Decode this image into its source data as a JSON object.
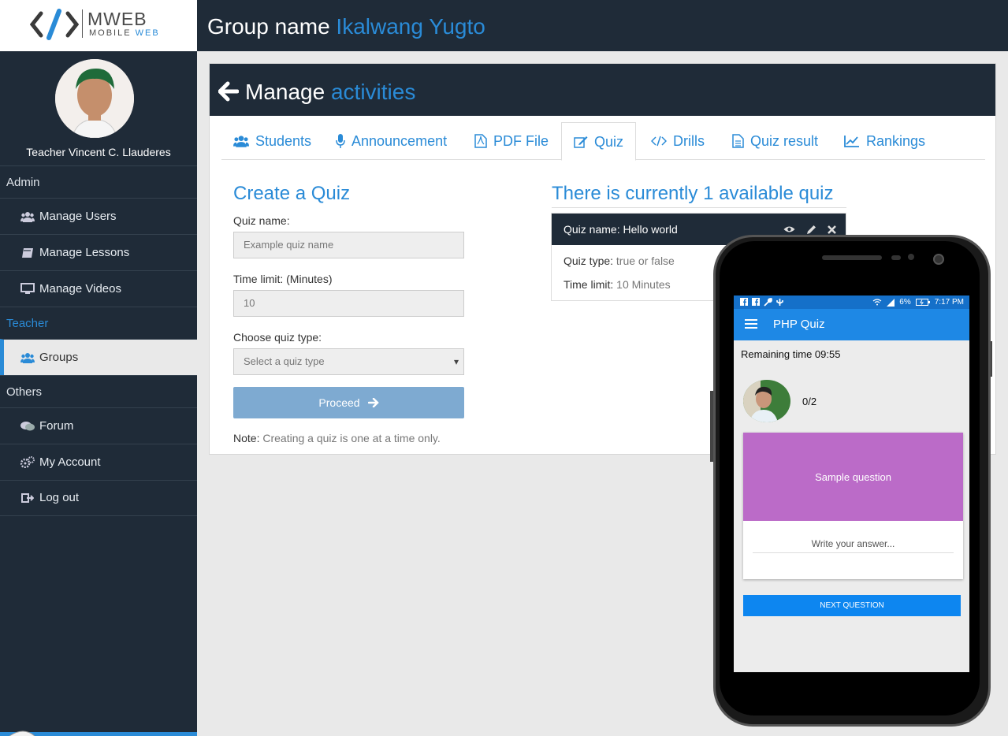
{
  "brand": {
    "logo_text": "MWEB",
    "logo_sub_1": "MOBILE",
    "logo_sub_2": "WEB"
  },
  "sidebar": {
    "teacher_name": "Teacher Vincent C. Llauderes",
    "section_admin": "Admin",
    "section_teacher": "Teacher",
    "section_others": "Others",
    "items": {
      "manage_users": "Manage Users",
      "manage_lessons": "Manage Lessons",
      "manage_videos": "Manage Videos",
      "groups": "Groups",
      "forum": "Forum",
      "my_account": "My Account",
      "log_out": "Log out"
    }
  },
  "header": {
    "prefix": "Group name",
    "group_name": "Ikalwang Yugto"
  },
  "panel": {
    "title_1": "Manage",
    "title_2": "activities",
    "tabs": {
      "students": "Students",
      "announcement": "Announcement",
      "pdf_file": "PDF File",
      "quiz": "Quiz",
      "drills": "Drills",
      "quiz_result": "Quiz result",
      "rankings": "Rankings"
    },
    "active_tab": "Quiz"
  },
  "create_form": {
    "title_1": "Create a",
    "title_2": "Quiz",
    "quiz_name_label": "Quiz name:",
    "quiz_name_placeholder": "Example quiz name",
    "time_limit_label": "Time limit: (Minutes)",
    "time_limit_value": "10",
    "quiz_type_label": "Choose quiz type:",
    "quiz_type_selected": "Select a quiz type",
    "proceed_label": "Proceed",
    "note_label": "Note:",
    "note_text": "Creating a quiz is one at a time only."
  },
  "available": {
    "title_1": "There is currently",
    "title_2": "1 available quiz",
    "quiz": {
      "name_label": "Quiz name:",
      "name": "Hello world",
      "type_label": "Quiz type:",
      "type": "true or false",
      "time_label": "Time limit:",
      "time": "10 Minutes"
    }
  },
  "phone": {
    "battery": "6%",
    "clock": "7:17 PM",
    "app_title": "PHP Quiz",
    "remaining": "Remaining time 09:55",
    "score": "0/2",
    "question": "Sample question",
    "answer_placeholder": "Write your answer...",
    "next_button": "NEXT QUESTION"
  },
  "colors": {
    "accent": "#2a8bd7",
    "dark": "#1f2b38",
    "card_purple": "#bb6bc8",
    "app_blue": "#1e88e5"
  }
}
